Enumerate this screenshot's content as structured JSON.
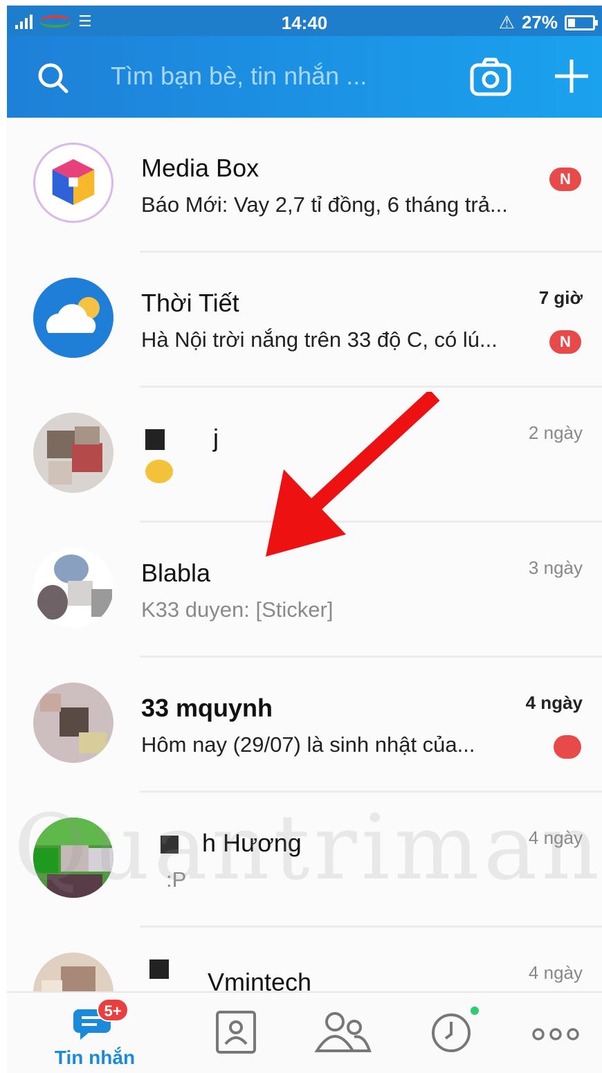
{
  "status_bar": {
    "time": "14:40",
    "battery": "27%",
    "icons": [
      "signal-icon",
      "carrier-logo-icon",
      "wifi-icon",
      "alarm-icon",
      "battery-icon"
    ]
  },
  "header": {
    "search_placeholder": "Tìm bạn bè, tin nhắn ...",
    "icons": [
      "search-icon",
      "camera-icon",
      "plus-icon"
    ]
  },
  "conversations": [
    {
      "name": "Media Box",
      "preview": "Báo Mới: Vay 2,7 tỉ đồng, 6 tháng trả...",
      "time": "",
      "badge": "N",
      "avatar_icon": "media-box-logo-icon"
    },
    {
      "name": "Thời Tiết",
      "preview": "Hà Nội trời nắng trên 33 độ C, có lú...",
      "time": "7 giờ",
      "badge": "N",
      "avatar_icon": "weather-cloud-sun-icon"
    },
    {
      "name": "j",
      "preview": "",
      "time": "2 ngày",
      "badge": "",
      "avatar_icon": "user-photo"
    },
    {
      "name": "Blabla",
      "preview": "K33 duyen: [Sticker]",
      "time": "3 ngày",
      "badge": "",
      "avatar_icon": "group-photo"
    },
    {
      "name": "33 mquynh",
      "preview": "Hôm nay (29/07) là sinh nhật của...",
      "time": "4 ngày",
      "badge": "",
      "avatar_icon": "user-photo"
    },
    {
      "name": "h Hương",
      "preview": ":P",
      "time": "4 ngày",
      "badge": "",
      "avatar_icon": "user-photo"
    },
    {
      "name": "Vmintech",
      "preview": "",
      "time": "4 ngày",
      "badge": "",
      "avatar_icon": "user-photo"
    }
  ],
  "bottom_nav": {
    "tabs": [
      {
        "label": "Tin nhắn",
        "icon": "chat-bubble-icon",
        "badge": "5+"
      },
      {
        "label": "",
        "icon": "contacts-icon",
        "badge": ""
      },
      {
        "label": "",
        "icon": "groups-icon",
        "badge": ""
      },
      {
        "label": "",
        "icon": "clock-icon",
        "badge": ""
      },
      {
        "label": "",
        "icon": "more-icon",
        "badge": ""
      }
    ]
  },
  "watermark": "Quantrimang",
  "colors": {
    "header_start": "#1e80d8",
    "header_end": "#1aa2ee",
    "badge_red": "#e84a4a",
    "active_tab": "#1a8ad9",
    "arrow_red": "#ee1111"
  }
}
